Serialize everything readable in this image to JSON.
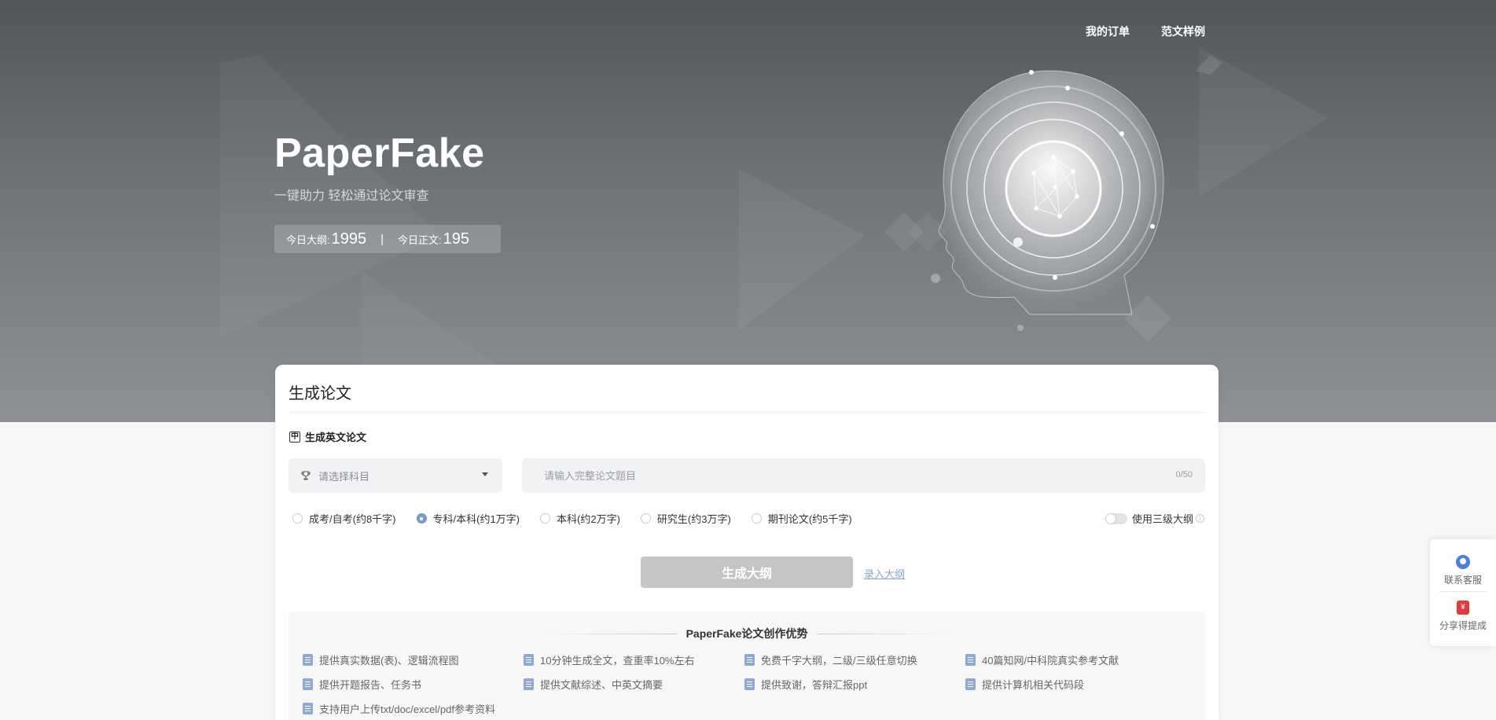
{
  "nav": {
    "orders": "我的订单",
    "samples": "范文样例"
  },
  "hero": {
    "title": "PaperFake",
    "subtitle": "一键助力 轻松通过论文审查",
    "stats": {
      "outline_label": "今日大纲:",
      "outline_value": "1995",
      "separator": "|",
      "body_label": "今日正文:",
      "body_value": "195"
    }
  },
  "card": {
    "title": "生成论文",
    "english_toggle": {
      "icon_text": "中",
      "label": "生成英文论文"
    },
    "subject": {
      "placeholder": "请选择科目"
    },
    "topic": {
      "placeholder": "请输入完整论文题目",
      "counter": "0/50"
    },
    "levels": [
      {
        "label": "成考/自考(约8千字)",
        "selected": false
      },
      {
        "label": "专科/本科(约1万字)",
        "selected": true
      },
      {
        "label": "本科(约2万字)",
        "selected": false
      },
      {
        "label": "研究生(约3万字)",
        "selected": false
      },
      {
        "label": "期刊论文(约5千字)",
        "selected": false
      }
    ],
    "outline3_label": "使用三级大纲",
    "generate_label": "生成大纲",
    "enter_outline_label": "录入大纲",
    "advantages": {
      "title": "PaperFake论文创作优势",
      "items": [
        "提供真实数据(表)、逻辑流程图",
        "10分钟生成全文，查重率10%左右",
        "免费千字大纲，二级/三级任意切换",
        "40篇知网/中科院真实参考文献",
        "提供开题报告、任务书",
        "提供文献综述、中英文摘要",
        "提供致谢，答辩汇报ppt",
        "提供计算机相关代码段",
        "支持用户上传txt/doc/excel/pdf参考资料"
      ]
    }
  },
  "side": {
    "service_label": "联系客服",
    "share_label": "分享得提成",
    "share_icon_text": "¥"
  },
  "colors": {
    "accent_blue": "#4b7fe0",
    "link": "#8ba6c9",
    "button_disabled": "#c4c5c7"
  }
}
